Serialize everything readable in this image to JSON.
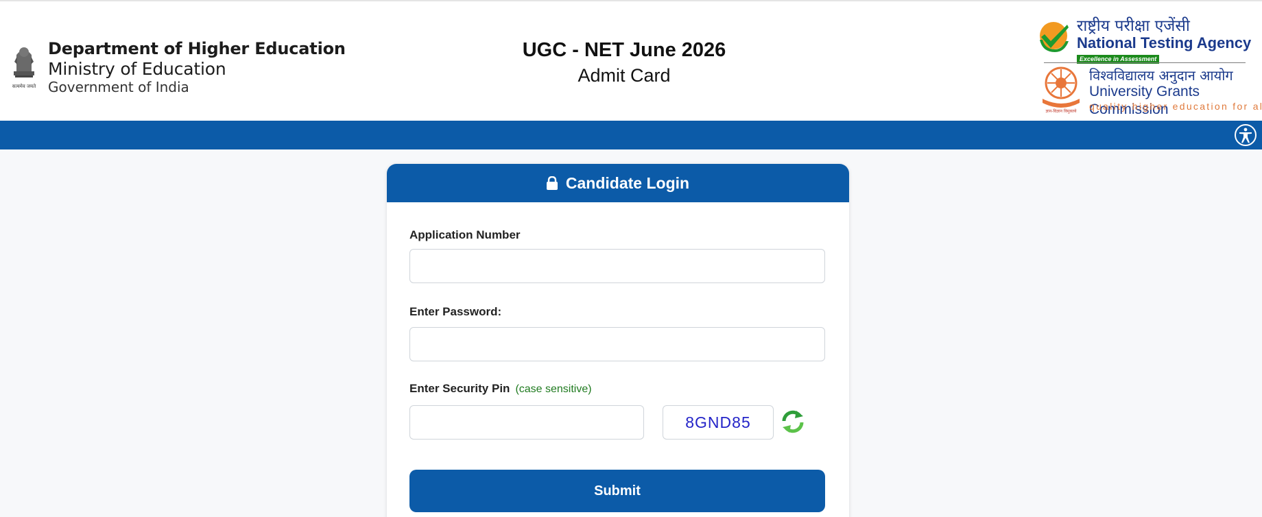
{
  "header": {
    "department_line1": "Department of Higher Education",
    "department_line2": "Ministry of Education",
    "department_line3": "Government of India",
    "emblem_caption": "सत्यमेव जयते",
    "exam_title": "UGC - NET June 2026",
    "exam_subtitle": "Admit Card"
  },
  "nta": {
    "hindi_name": "राष्ट्रीय परीक्षा एजेंसी",
    "name": "National Testing Agency",
    "tagline": "Excellence in Assessment"
  },
  "ugc": {
    "hindi_name": "विश्वविद्यालय अनुदान आयोग",
    "name": "University Grants Commission",
    "tagline": "quality higher education for all",
    "seal_caption": "ज्ञान-विज्ञान विमुक्तये"
  },
  "accessibility": {
    "icon": "accessibility-icon"
  },
  "login": {
    "title": "Candidate Login",
    "lock_icon": "lock-icon",
    "application_label": "Application Number",
    "application_value": "",
    "password_label": "Enter Password:",
    "password_value": "",
    "pin_label": "Enter Security Pin",
    "pin_hint": "(case sensitive)",
    "pin_value": "",
    "captcha_text": "8GND85",
    "refresh_icon": "refresh-icon",
    "submit_label": "Submit"
  },
  "colors": {
    "primary": "#0c5ba8",
    "captcha_text": "#2424c8",
    "hint_green": "#1f7a1f",
    "nta_blue": "#1b3a8c",
    "ugc_orange": "#e07a3c"
  }
}
